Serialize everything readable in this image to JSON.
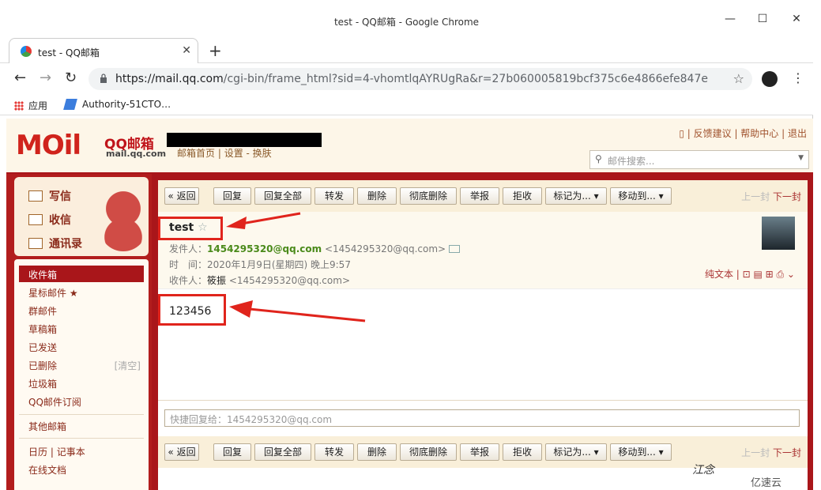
{
  "window": {
    "title": "test - QQ邮箱 - Google Chrome",
    "min": "—",
    "max": "☐",
    "close": "✕"
  },
  "tab": {
    "label": "test - QQ邮箱",
    "close": "✕",
    "new": "+"
  },
  "address": {
    "url_host": "https://mail.qq.com",
    "url_path": "/cgi-bin/frame_html?sid=4-vhomtlqAYRUgRa&r=27b060005819bcf375c6e4866efe847e",
    "back": "←",
    "forward": "→",
    "reload": "↻",
    "star": "☆",
    "menu": "⋮"
  },
  "bookmarks": [
    {
      "label": "应用"
    },
    {
      "label": "Authority-51CTO…"
    }
  ],
  "qq": {
    "logo_main": "MOil",
    "logo_cn": "QQ邮箱",
    "logo_en": "mail.qq.com",
    "header_links": {
      "home": "邮箱首页",
      "settings": "设置",
      "skin": "换肤"
    },
    "top_links": {
      "feedback": "反馈建议",
      "help": "帮助中心",
      "logout": "退出"
    },
    "search_placeholder": "邮件搜索..."
  },
  "sidebar": {
    "actions": [
      {
        "label": "写信"
      },
      {
        "label": "收信"
      },
      {
        "label": "通讯录"
      }
    ],
    "folders": [
      {
        "label": "收件箱"
      },
      {
        "label": "星标邮件 ★"
      },
      {
        "label": "群邮件"
      },
      {
        "label": "草稿箱"
      },
      {
        "label": "已发送"
      },
      {
        "label": "已删除",
        "extra": "[清空]"
      },
      {
        "label": "垃圾箱"
      },
      {
        "label": "QQ邮件订阅"
      }
    ],
    "other": "其他邮箱",
    "calendar": "日历",
    "notes": "记事本",
    "docs": "在线文档"
  },
  "toolbar": {
    "back": "« 返回",
    "reply": "回复",
    "reply_all": "回复全部",
    "forward": "转发",
    "delete": "删除",
    "purge": "彻底删除",
    "report": "举报",
    "reject": "拒收",
    "mark": "标记为... ▾",
    "move": "移动到... ▾",
    "prev": "上一封",
    "next": "下一封"
  },
  "message": {
    "subject": "test",
    "star": "☆",
    "from_label": "发件人：",
    "from_name": "1454295320@qq.com",
    "from_addr": "<1454295320@qq.com>",
    "time_label": "时　间：",
    "time": "2020年1月9日(星期四) 晚上9:57",
    "to_label": "收件人：",
    "to_name": "筱振",
    "to_addr": "<1454295320@qq.com>",
    "plain": "纯文本 | ⊡ ▤ ⊞ ⎙ ⌄",
    "body": "123456",
    "quick_reply": "快捷回复给：1454295320@qq.com"
  },
  "watermark": {
    "text1": "江念",
    "text2": "亿速云"
  }
}
